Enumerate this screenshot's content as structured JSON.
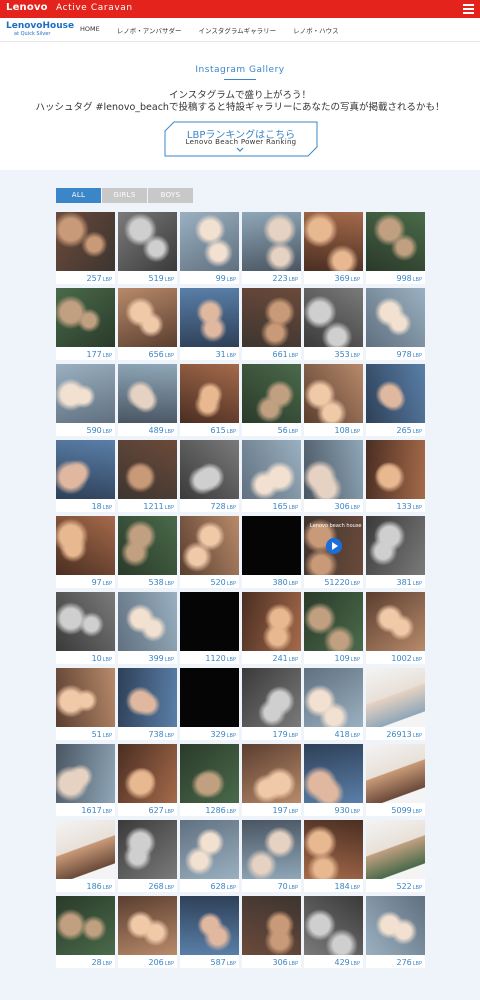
{
  "header": {
    "brand": "Lenovo",
    "subtitle": "Active Caravan"
  },
  "nav": {
    "logo_line1": "LenovoHouse",
    "logo_line2": "at Quick Silver",
    "items": [
      "HOME",
      "レノボ・アンバサダー",
      "インスタグラムギャラリー",
      "レノボ・ハウス"
    ]
  },
  "hero": {
    "title": "Instagram Gallery",
    "line1": "インスタグラムで盛り上がろう！",
    "line2": "ハッシュタグ #lenovo_beachで投稿すると特設ギャラリーにあなたの写真が掲載されるかも！",
    "ranking_title": "LBPランキングはこちら",
    "ranking_sub": "Lenovo Beach Power Ranking"
  },
  "tabs": [
    "ALL",
    "GIRLS",
    "BOYS"
  ],
  "unit": "LBP",
  "video_label": "Lenovo beach house",
  "scores": [
    [
      "257",
      "519",
      "99",
      "223",
      "369",
      "998"
    ],
    [
      "177",
      "656",
      "31",
      "661",
      "353",
      "978"
    ],
    [
      "590",
      "489",
      "615",
      "56",
      "108",
      "265"
    ],
    [
      "18",
      "1211",
      "728",
      "165",
      "306",
      "133"
    ],
    [
      "97",
      "538",
      "520",
      "380",
      "51220",
      "381"
    ],
    [
      "10",
      "399",
      "1120",
      "241",
      "109",
      "1002"
    ],
    [
      "51",
      "738",
      "329",
      "179",
      "418",
      "26913"
    ],
    [
      "1617",
      "627",
      "1286",
      "197",
      "930",
      "5099"
    ],
    [
      "186",
      "268",
      "628",
      "70",
      "184",
      "522"
    ],
    [
      "28",
      "206",
      "587",
      "306",
      "429",
      "276"
    ]
  ]
}
